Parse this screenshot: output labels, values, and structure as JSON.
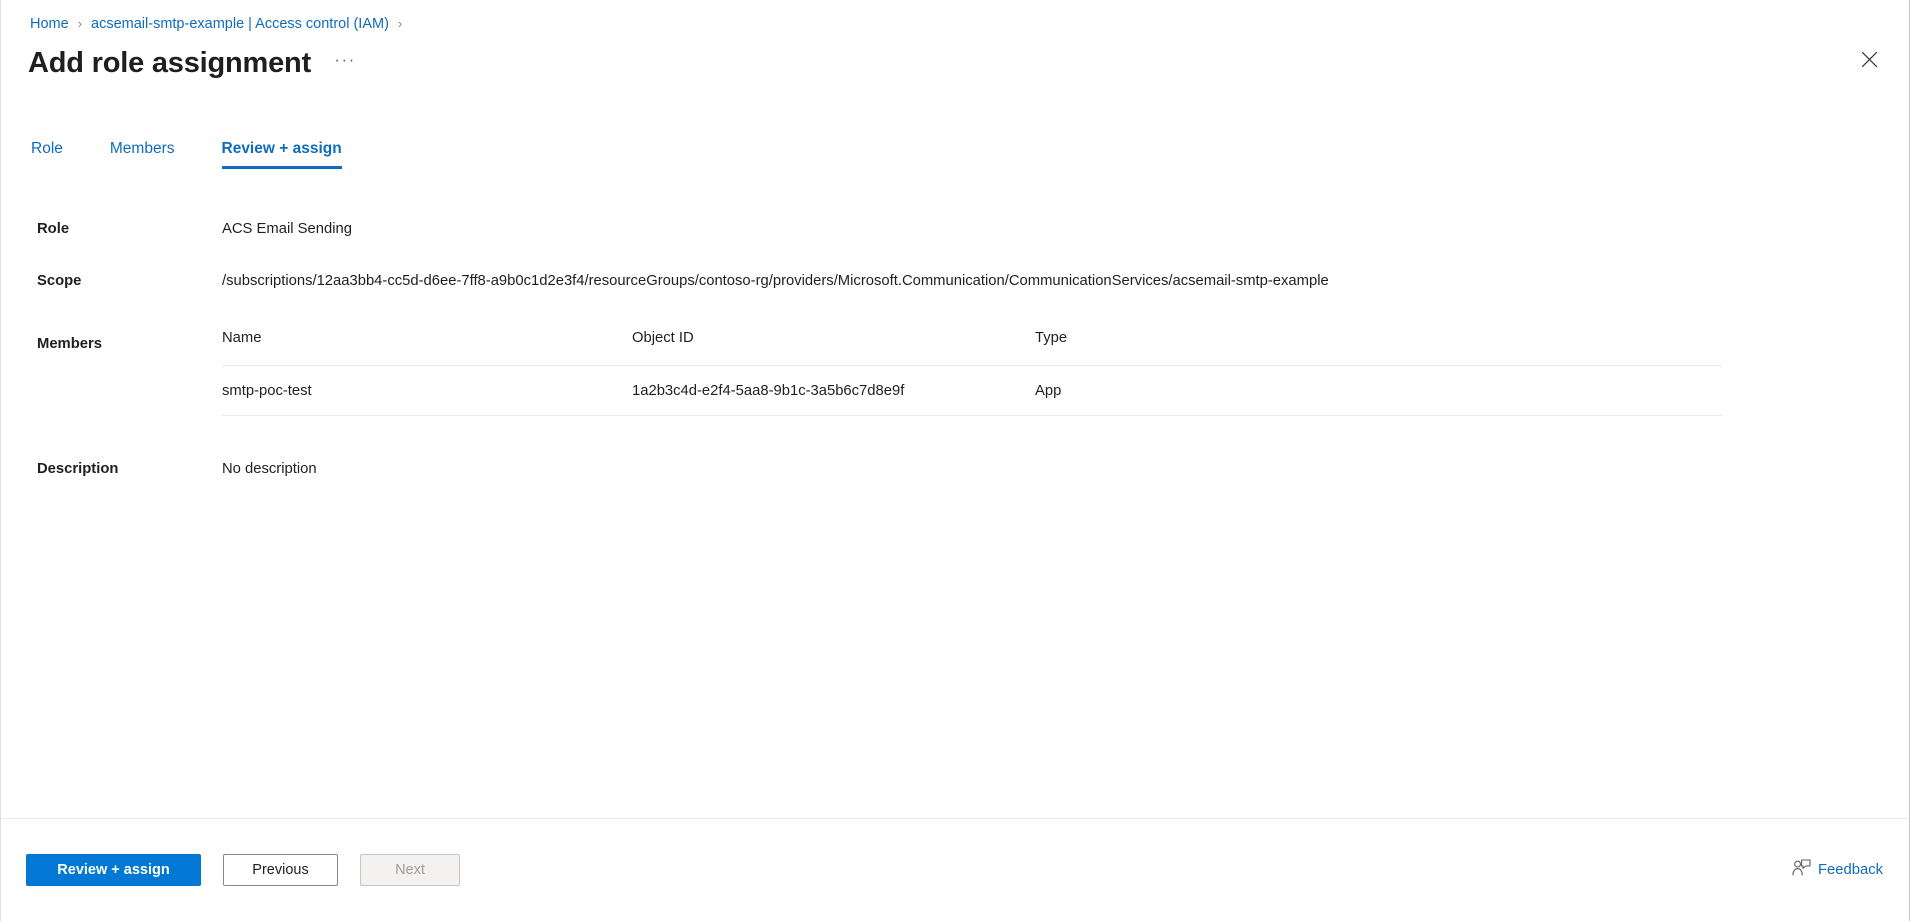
{
  "breadcrumb": {
    "items": [
      {
        "label": "Home"
      },
      {
        "label": "acsemail-smtp-example | Access control (IAM)"
      }
    ],
    "separator": "›"
  },
  "header": {
    "title": "Add role assignment",
    "more_label": "···",
    "more_icon": "ellipsis-icon",
    "close_icon": "close-icon",
    "close_label": "Close"
  },
  "tabs": [
    {
      "label": "Role",
      "selected": false
    },
    {
      "label": "Members",
      "selected": false
    },
    {
      "label": "Review + assign",
      "selected": true
    }
  ],
  "fields": {
    "role": {
      "label": "Role",
      "value": "ACS Email Sending"
    },
    "scope": {
      "label": "Scope",
      "value": "/subscriptions/12aa3bb4-cc5d-d6ee-7ff8-a9b0c1d2e3f4/resourceGroups/contoso-rg/providers/Microsoft.Communication/CommunicationServices/acsemail-smtp-example"
    },
    "members": {
      "label": "Members"
    },
    "description": {
      "label": "Description",
      "value": "No description"
    }
  },
  "members_table": {
    "columns": [
      "Name",
      "Object ID",
      "Type"
    ],
    "rows": [
      {
        "name": "smtp-poc-test",
        "object_id": "1a2b3c4d-e2f4-5aa8-9b1c-3a5b6c7d8e9f",
        "type": "App"
      }
    ]
  },
  "footer": {
    "primary_button": "Review + assign",
    "previous_button": "Previous",
    "next_button": "Next",
    "feedback_label": "Feedback",
    "feedback_icon": "person-feedback-icon"
  },
  "colors": {
    "accent_blue": "#0078d4",
    "link_blue": "#0f6cbd",
    "text": "#201f1e",
    "divider": "#edebe9",
    "disabled_text": "#a19f9d",
    "panel_border": "#c8c6c4"
  }
}
